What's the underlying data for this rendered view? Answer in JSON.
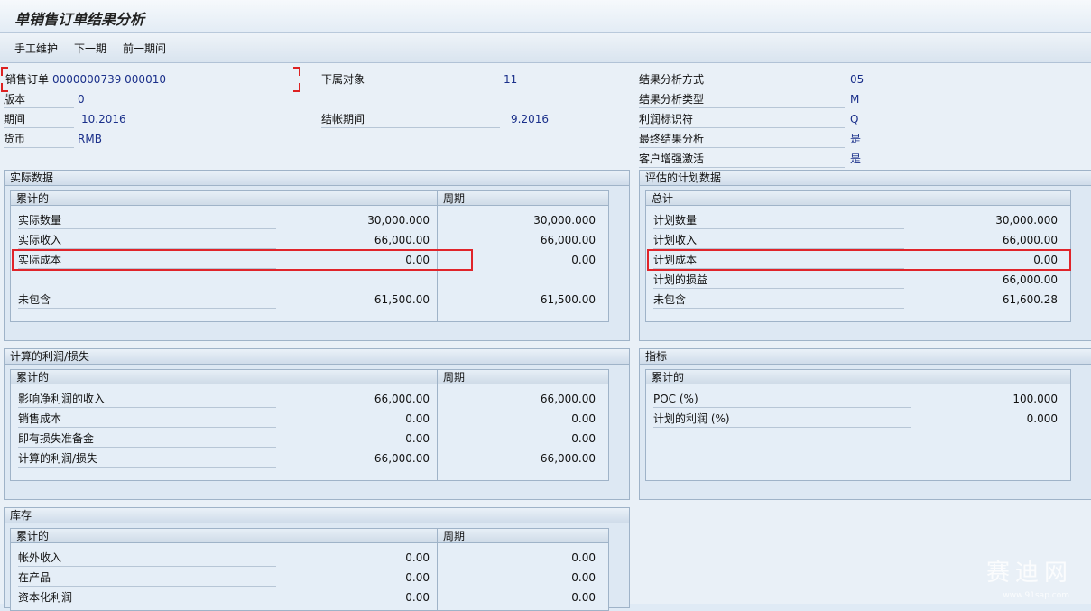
{
  "window": {
    "title": "单销售订单结果分析"
  },
  "toolbar": {
    "manual": "手工维护",
    "next": "下一期",
    "prev": "前一期间"
  },
  "header": {
    "sales_order_label": "销售订单",
    "sales_order_value": "0000000739 000010",
    "version_label": "版本",
    "version_value": "0",
    "period_label": "期间",
    "period_value": "10.2016",
    "currency_label": "货币",
    "currency_value": "RMB",
    "sub_obj_label": "下属对象",
    "sub_obj_value": "11",
    "closing_label": "结帐期间",
    "closing_value": "9.2016",
    "ra_method_label": "结果分析方式",
    "ra_method_value": "05",
    "ra_type_label": "结果分析类型",
    "ra_type_value": "M",
    "profit_ind_label": "利润标识符",
    "profit_ind_value": "Q",
    "final_ra_label": "最终结果分析",
    "final_ra_value": "是",
    "cust_enh_label": "客户增强激活",
    "cust_enh_value": "是"
  },
  "actual": {
    "title": "实际数据",
    "col1": "累计的",
    "col2": "周期",
    "rows": [
      {
        "label": "实际数量",
        "cum": "30,000.000",
        "per": "30,000.000"
      },
      {
        "label": "实际收入",
        "cum": "66,000.00",
        "per": "66,000.00"
      },
      {
        "label": "实际成本",
        "cum": "0.00",
        "per": "0.00"
      },
      {
        "label": "未包含",
        "cum": "61,500.00",
        "per": "61,500.00"
      }
    ]
  },
  "planned": {
    "title": "评估的计划数据",
    "col1": "总计",
    "rows": [
      {
        "label": "计划数量",
        "val": "30,000.000"
      },
      {
        "label": "计划收入",
        "val": "66,000.00"
      },
      {
        "label": "计划成本",
        "val": "0.00"
      },
      {
        "label": "计划的损益",
        "val": "66,000.00"
      },
      {
        "label": "未包含",
        "val": "61,600.28"
      }
    ]
  },
  "calc": {
    "title": "计算的利润/损失",
    "col1": "累计的",
    "col2": "周期",
    "rows": [
      {
        "label": "影响净利润的收入",
        "cum": "66,000.00",
        "per": "66,000.00"
      },
      {
        "label": "销售成本",
        "cum": "0.00",
        "per": "0.00"
      },
      {
        "label": "即有损失准备金",
        "cum": "0.00",
        "per": "0.00"
      },
      {
        "label": "计算的利润/损失",
        "cum": "66,000.00",
        "per": "66,000.00"
      }
    ]
  },
  "indicators": {
    "title": "指标",
    "col1": "累计的",
    "rows": [
      {
        "label": "POC (%)",
        "val": "100.000"
      },
      {
        "label": "计划的利润 (%)",
        "val": "0.000"
      }
    ]
  },
  "inventory": {
    "title": "库存",
    "col1": "累计的",
    "col2": "周期",
    "rows": [
      {
        "label": "帐外收入",
        "cum": "0.00",
        "per": "0.00"
      },
      {
        "label": "在产品",
        "cum": "0.00",
        "per": "0.00"
      },
      {
        "label": "资本化利润",
        "cum": "0.00",
        "per": "0.00"
      }
    ]
  },
  "colors": {
    "highlight": "#e0242a",
    "value_blue": "#1a2f8a"
  },
  "watermark": {
    "text": "赛迪网",
    "url": "www.91sap.com"
  }
}
